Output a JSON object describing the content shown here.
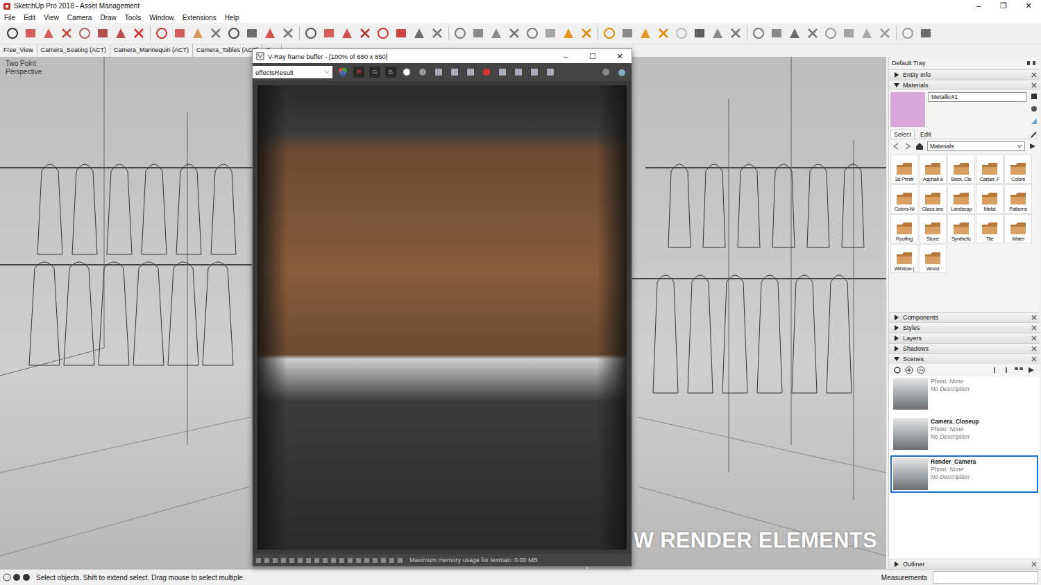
{
  "window": {
    "title": "SketchUp Pro 2018 - Asset Management",
    "controls": [
      "–",
      "❐",
      "✕"
    ]
  },
  "menu": [
    "File",
    "Edit",
    "View",
    "Camera",
    "Draw",
    "Tools",
    "Window",
    "Extensions",
    "Help"
  ],
  "scene_tabs": [
    "Free_View",
    "Camera_Seating (ACT)",
    "Camera_Mannequin (ACT)",
    "Camera_Tables (ACT)",
    "Can"
  ],
  "viewport": {
    "labels": [
      "Two Point",
      "Perspective"
    ],
    "caption": "NEW RENDER ELEMENTS"
  },
  "vfb": {
    "title": "V-Ray frame buffer - [100% of 680 x 850]",
    "controls": [
      "–",
      "☐",
      "✕"
    ],
    "channel": "effectsResult",
    "channel_buttons": [
      {
        "label": "R",
        "color": "#e04040"
      },
      {
        "label": "G",
        "color": "#9a9a9a"
      },
      {
        "label": "B",
        "color": "#9a9a9a"
      }
    ],
    "status": "Maximum memory usage for texman: 0.00 MB"
  },
  "tray": {
    "title": "Default Tray",
    "top_sections": [
      {
        "label": "Entity Info",
        "expanded": false
      },
      {
        "label": "Materials",
        "expanded": true
      }
    ],
    "materials": {
      "name": "Metallic#1",
      "color": "#d9a6d9",
      "tabs": [
        {
          "label": "Select",
          "selected": true
        },
        {
          "label": "Edit",
          "selected": false
        }
      ],
      "library": "Materials",
      "items": [
        "3d Printir",
        "Asphalt a",
        "Brick, Cle",
        "Carpet, F",
        "Colors",
        "Colors-Ni",
        "Glass anc",
        "Landscap",
        "Metal",
        "Patterns",
        "Roofing",
        "Stone",
        "Synthetic",
        "Tile",
        "Water",
        "Window (",
        "Wood"
      ]
    },
    "middle_sections": [
      {
        "label": "Components",
        "expanded": false
      },
      {
        "label": "Styles",
        "expanded": false
      },
      {
        "label": "Layers",
        "expanded": false
      },
      {
        "label": "Shadows",
        "expanded": false
      },
      {
        "label": "Scenes",
        "expanded": true
      }
    ],
    "scenes": [
      {
        "name": "",
        "photo": "Photo: None",
        "description": "No Description",
        "selected": false
      },
      {
        "name": "Camera_Closeup",
        "photo": "Photo: None",
        "description": "No Description",
        "selected": false
      },
      {
        "name": "Render_Camera",
        "photo": "Photo: None",
        "description": "No Description",
        "selected": true
      }
    ],
    "bottom_sections": [
      {
        "label": "Outliner",
        "expanded": false
      }
    ]
  },
  "status_bar": {
    "message": "Select objects. Shift to extend select. Drag mouse to select multiple.",
    "measurements": "Measurements"
  }
}
